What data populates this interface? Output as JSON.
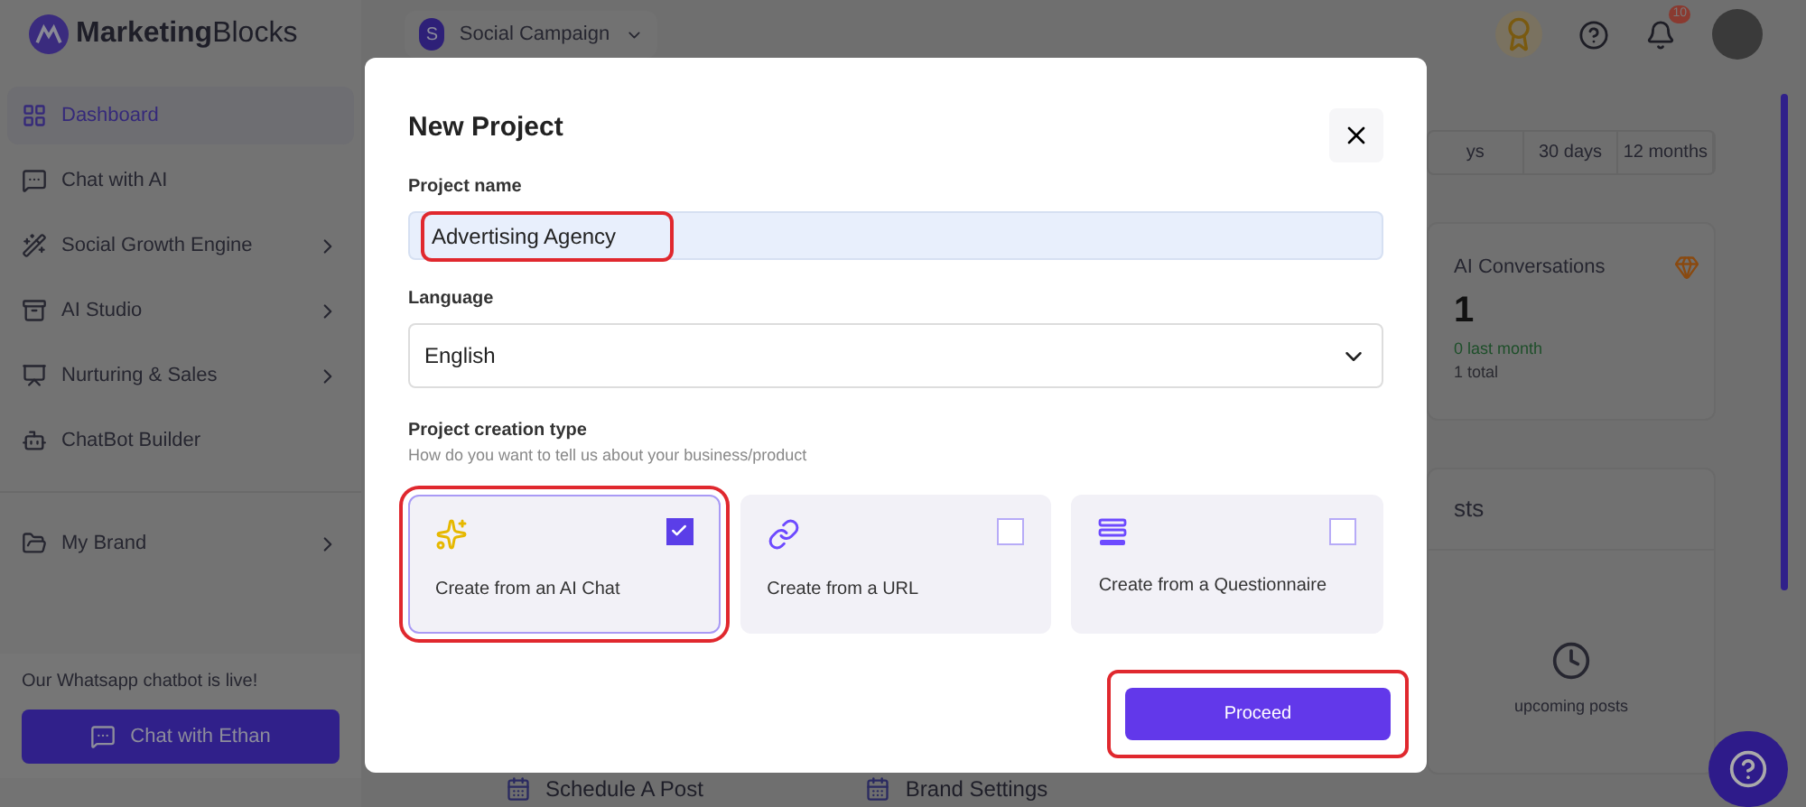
{
  "brand": {
    "name_bold": "Marketing",
    "name_light": "Blocks"
  },
  "campaign": {
    "initial": "S",
    "name": "Social Campaign"
  },
  "notifications": {
    "count": "10"
  },
  "sidebar": {
    "items": [
      {
        "label": "Dashboard",
        "kind": "link",
        "selected": true
      },
      {
        "label": "Chat with AI",
        "kind": "link",
        "selected": false
      },
      {
        "label": "Social Growth Engine",
        "kind": "group",
        "selected": false
      },
      {
        "label": "AI Studio",
        "kind": "group",
        "selected": false
      },
      {
        "label": "Nurturing & Sales",
        "kind": "group",
        "selected": false
      },
      {
        "label": "ChatBot Builder",
        "kind": "link",
        "selected": false
      },
      {
        "label": "My Brand",
        "kind": "group",
        "selected": false
      }
    ],
    "promo": {
      "text": "Our Whatsapp chatbot is live!",
      "button": "Chat with Ethan"
    }
  },
  "dashboard": {
    "ranges": [
      {
        "label": "ys",
        "selected": false
      },
      {
        "label": "30 days",
        "selected": false
      },
      {
        "label": "12 months",
        "selected": false
      }
    ],
    "stat": {
      "title": "AI Conversations",
      "value": "1",
      "change": "0 last month",
      "total": "1 total"
    },
    "posts": {
      "title": "sts",
      "empty": "upcoming posts"
    },
    "shortcuts": [
      "Schedule A Post",
      "Brand Settings"
    ]
  },
  "dialog": {
    "title": "New Project",
    "name_field": {
      "label": "Project name",
      "value": "Advertising Agency",
      "highlighted": true
    },
    "language_field": {
      "label": "Language",
      "value": "English"
    },
    "creation": {
      "label": "Project creation type",
      "hint": "How do you want to tell us about your business/product",
      "options": [
        {
          "label": "Create from an AI Chat",
          "selected": true,
          "highlighted": true
        },
        {
          "label": "Create from a URL",
          "selected": false,
          "highlighted": false
        },
        {
          "label": "Create from a Questionnaire",
          "selected": false,
          "highlighted": false
        }
      ]
    },
    "proceed": {
      "label": "Proceed",
      "highlighted": true
    }
  }
}
